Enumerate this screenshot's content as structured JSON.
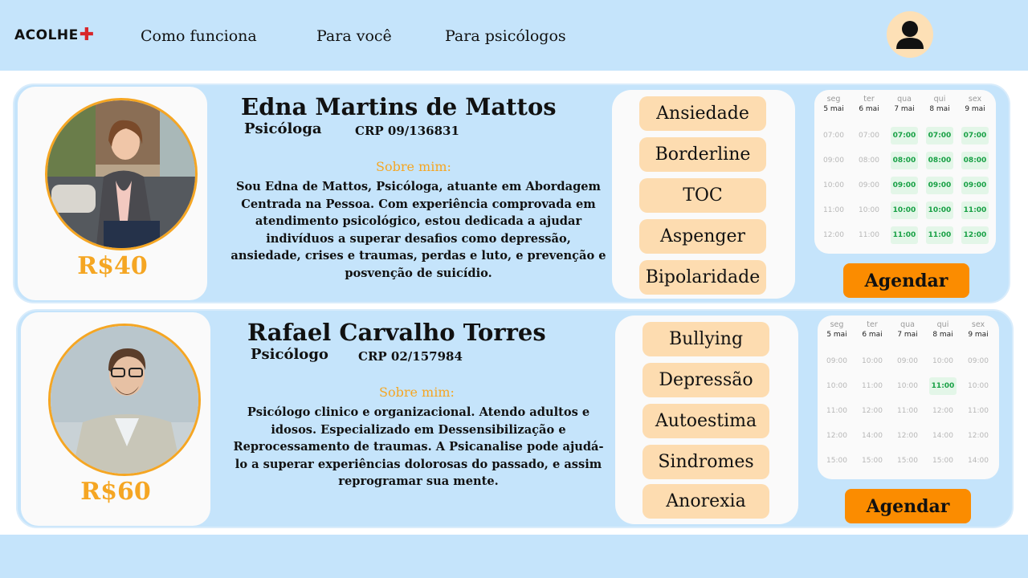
{
  "header": {
    "logo": "ACOLHE",
    "nav": [
      "Como funciona",
      "Para você",
      "Para psicólogos"
    ]
  },
  "professionals": [
    {
      "name": "Edna Martins de Mattos",
      "role": "Psicóloga",
      "crp": "CRP 09/136831",
      "price": "R$40",
      "about_title": "Sobre mim:",
      "about": "Sou Edna de Mattos, Psicóloga, atuante em Abordagem Centrada na Pessoa. Com experiência comprovada em atendimento psicológico, estou dedicada a ajudar indivíduos a superar desafios como depressão, ansiedade, crises e traumas, perdas e luto, e prevenção e posvenção de suicídio.",
      "tags": [
        "Ansiedade",
        "Borderline",
        "TOC",
        "Aspenger",
        "Bipolaridade"
      ],
      "schedule": [
        {
          "day": "seg",
          "date": "5 mai",
          "slots": [
            [
              "07:00",
              false
            ],
            [
              "09:00",
              false
            ],
            [
              "10:00",
              false
            ],
            [
              "11:00",
              false
            ],
            [
              "12:00",
              false
            ]
          ]
        },
        {
          "day": "ter",
          "date": "6 mai",
          "slots": [
            [
              "07:00",
              false
            ],
            [
              "08:00",
              false
            ],
            [
              "09:00",
              false
            ],
            [
              "10:00",
              false
            ],
            [
              "11:00",
              false
            ]
          ]
        },
        {
          "day": "qua",
          "date": "7 mai",
          "slots": [
            [
              "07:00",
              true
            ],
            [
              "08:00",
              true
            ],
            [
              "09:00",
              true
            ],
            [
              "10:00",
              true
            ],
            [
              "11:00",
              true
            ]
          ]
        },
        {
          "day": "qui",
          "date": "8 mai",
          "slots": [
            [
              "07:00",
              true
            ],
            [
              "08:00",
              true
            ],
            [
              "09:00",
              true
            ],
            [
              "10:00",
              true
            ],
            [
              "11:00",
              true
            ]
          ]
        },
        {
          "day": "sex",
          "date": "9 mai",
          "slots": [
            [
              "07:00",
              true
            ],
            [
              "08:00",
              true
            ],
            [
              "09:00",
              true
            ],
            [
              "11:00",
              true
            ],
            [
              "12:00",
              true
            ]
          ]
        }
      ],
      "book_label": "Agendar"
    },
    {
      "name": "Rafael Carvalho Torres",
      "role": "Psicólogo",
      "crp": "CRP 02/157984",
      "price": "R$60",
      "about_title": "Sobre mim:",
      "about": "Psicólogo clinico e organizacional. Atendo adultos e idosos. Especializado em Dessensibilização e Reprocessamento de traumas. A Psicanalise pode ajudá-lo a superar experiências dolorosas do passado, e assim reprogramar sua mente.",
      "tags": [
        "Bullying",
        "Depressão",
        "Autoestima",
        "Sindromes",
        "Anorexia"
      ],
      "schedule": [
        {
          "day": "seg",
          "date": "5 mai",
          "slots": [
            [
              "09:00",
              false
            ],
            [
              "10:00",
              false
            ],
            [
              "11:00",
              false
            ],
            [
              "12:00",
              false
            ],
            [
              "15:00",
              false
            ]
          ]
        },
        {
          "day": "ter",
          "date": "6 mai",
          "slots": [
            [
              "10:00",
              false
            ],
            [
              "11:00",
              false
            ],
            [
              "12:00",
              false
            ],
            [
              "14:00",
              false
            ],
            [
              "15:00",
              false
            ]
          ]
        },
        {
          "day": "qua",
          "date": "7 mai",
          "slots": [
            [
              "09:00",
              false
            ],
            [
              "10:00",
              false
            ],
            [
              "11:00",
              false
            ],
            [
              "12:00",
              false
            ],
            [
              "15:00",
              false
            ]
          ]
        },
        {
          "day": "qui",
          "date": "8 mai",
          "slots": [
            [
              "10:00",
              false
            ],
            [
              "11:00",
              true
            ],
            [
              "12:00",
              false
            ],
            [
              "14:00",
              false
            ],
            [
              "15:00",
              false
            ]
          ]
        },
        {
          "day": "sex",
          "date": "9 mai",
          "slots": [
            [
              "09:00",
              false
            ],
            [
              "10:00",
              false
            ],
            [
              "11:00",
              false
            ],
            [
              "12:00",
              false
            ],
            [
              "14:00",
              false
            ]
          ]
        }
      ],
      "book_label": "Agendar"
    }
  ],
  "colors": {
    "background_blue": "#c5e4fb",
    "accent_orange": "#f5a623",
    "button_orange": "#fb8c00",
    "tag_peach": "#fddcb0",
    "available_green": "#18a045"
  }
}
